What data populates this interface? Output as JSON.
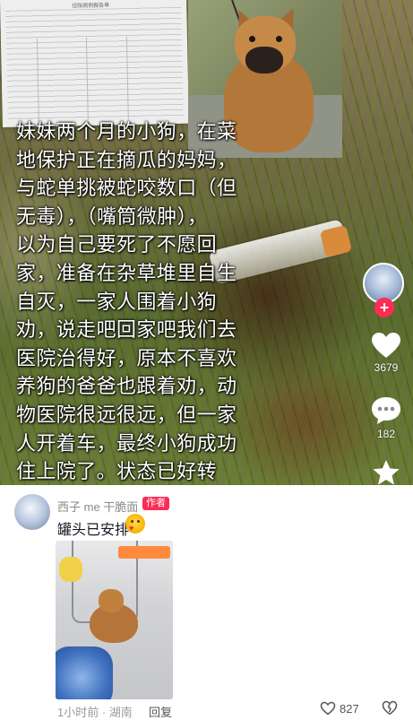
{
  "video": {
    "report_title": "住院病例报告单",
    "caption": "妹妹两个月的小狗，在菜\n地保护正在摘瓜的妈妈，\n与蛇单挑被蛇咬数口（但\n无毒），（嘴筒微肿），\n以为自己要死了不愿回\n家，准备在杂草堆里自生\n自灭，一家人围着小狗\n劝，说走吧回家吧我们去\n医院治得好，原本不喜欢\n养狗的爸爸也跟着劝，动\n物医院很远很远，但一家\n人开着车，最终小狗成功\n住上院了。状态已好转",
    "follow_symbol": "+",
    "like_count": "3679",
    "comment_count": "182"
  },
  "comment": {
    "username": "西子 me 干脆面",
    "author_badge": "作者",
    "text": "罐头已安排",
    "meta": "1小时前 · 湖南",
    "reply_label": "回复",
    "like_count": "827"
  },
  "colors": {
    "accent": "#fe2c55",
    "text_primary": "#161823",
    "text_secondary": "#8a8a8a"
  },
  "icons": [
    "heart-icon",
    "comment-bubble-icon",
    "star-icon",
    "like-heart-outline-icon",
    "dislike-broken-heart-icon",
    "plus-icon"
  ]
}
